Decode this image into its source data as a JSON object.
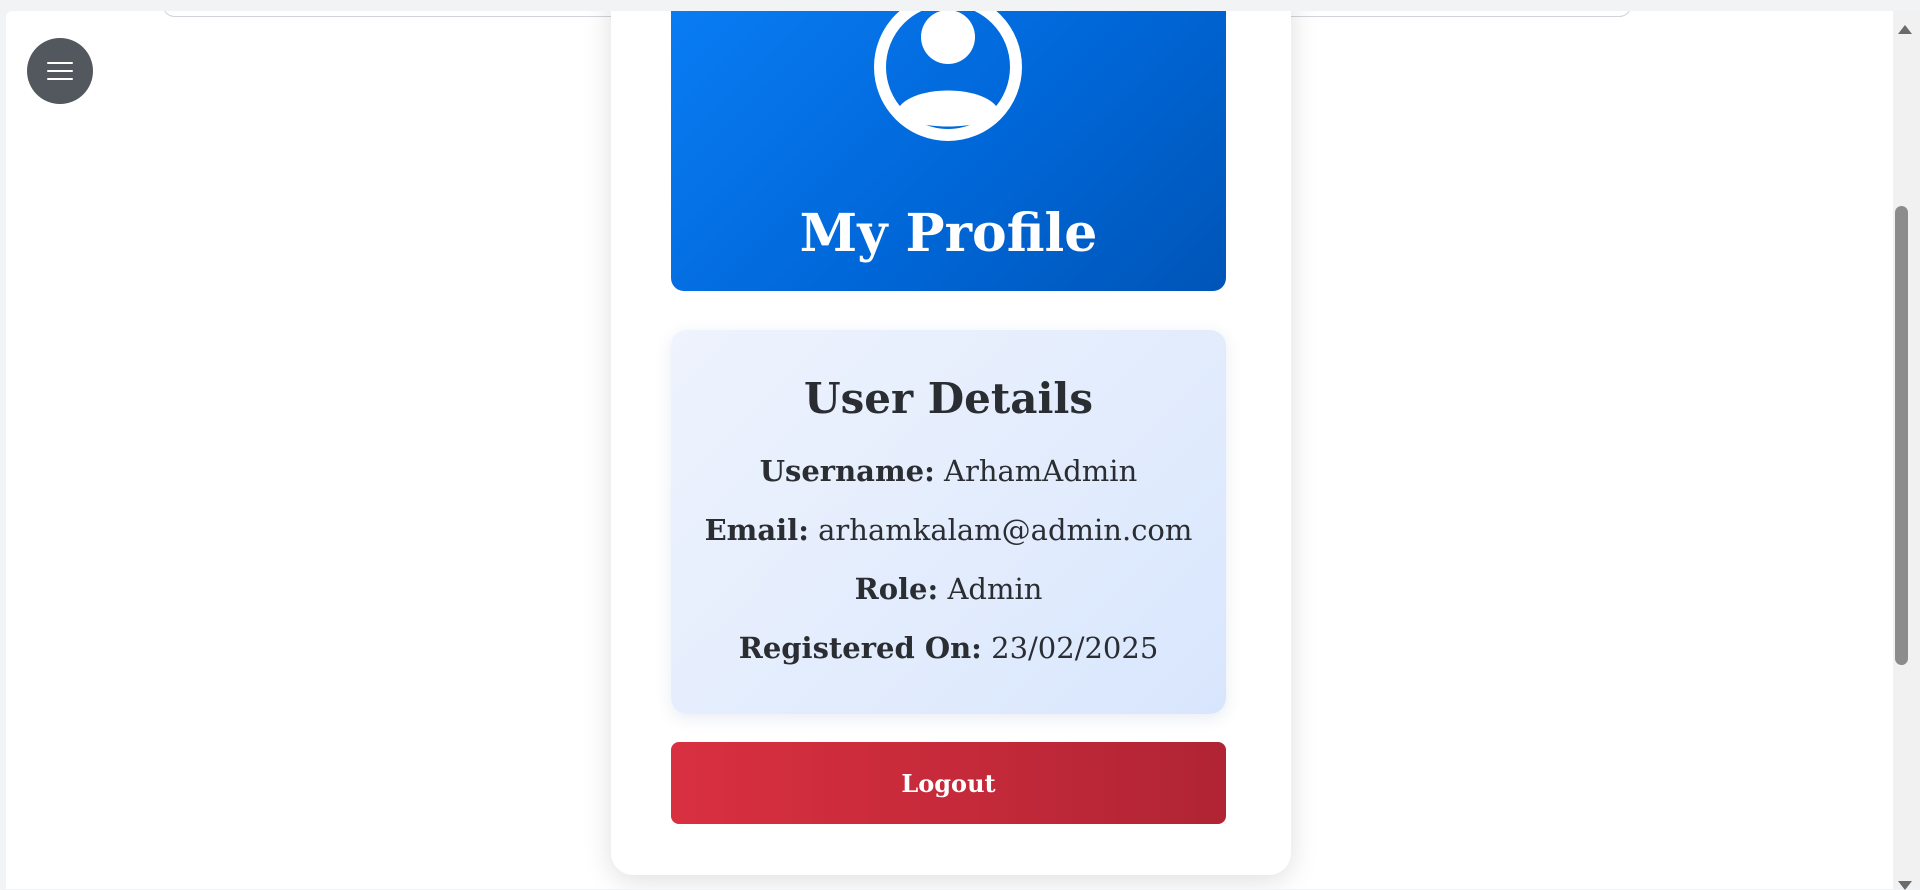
{
  "header": {
    "title": "My Profile",
    "avatar_icon": "user-circle-icon"
  },
  "menu": {
    "icon": "hamburger-menu-icon"
  },
  "details": {
    "title": "User Details",
    "rows": [
      {
        "label": "Username:",
        "value": "ArhamAdmin"
      },
      {
        "label": "Email:",
        "value": "arhamkalam@admin.com"
      },
      {
        "label": "Role:",
        "value": "Admin"
      },
      {
        "label": "Registered On:",
        "value": "23/02/2025"
      }
    ]
  },
  "actions": {
    "logout_label": "Logout"
  },
  "colors": {
    "header_gradient_start": "#0a7df5",
    "header_gradient_end": "#0055b7",
    "details_bg": "#e4edfd",
    "logout_start": "#d93040",
    "logout_end": "#b02434",
    "menu_button": "#52585e"
  }
}
